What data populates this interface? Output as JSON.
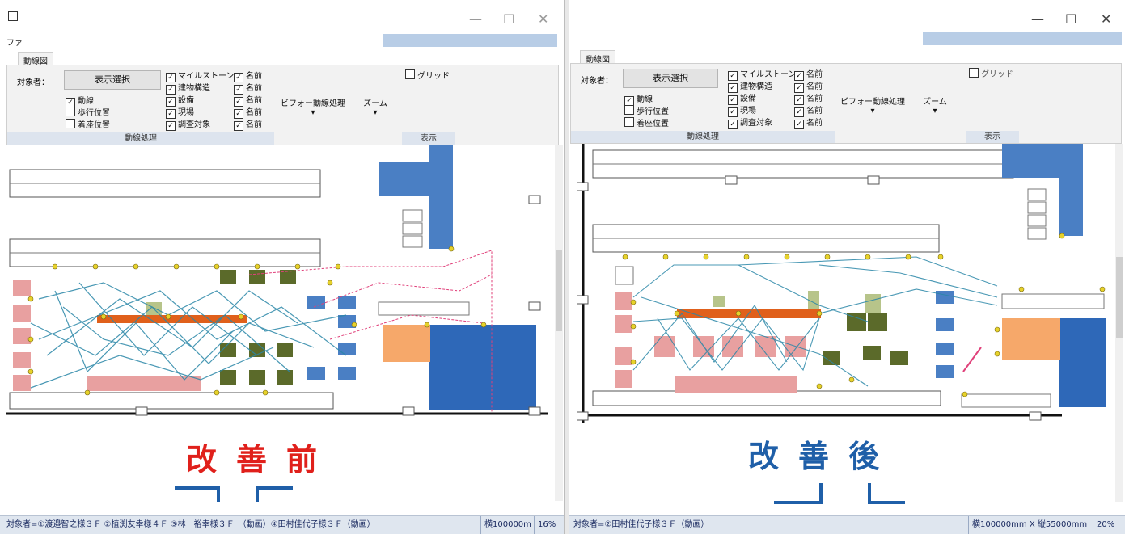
{
  "left": {
    "menu": "ファ",
    "tab": "動線図",
    "subject_label": "対象者：",
    "select_button": "表示選択",
    "checks": [
      {
        "label": "動線",
        "checked": true
      },
      {
        "label": "歩行位置",
        "checked": false
      },
      {
        "label": "着座位置",
        "checked": false
      }
    ],
    "checks2": [
      {
        "label": "マイルストーン",
        "checked": true
      },
      {
        "label": "建物構造",
        "checked": true
      },
      {
        "label": "設備",
        "checked": true
      },
      {
        "label": "現場",
        "checked": true
      },
      {
        "label": "調査対象",
        "checked": true
      }
    ],
    "names": [
      "名前",
      "名前",
      "名前",
      "名前",
      "名前"
    ],
    "group_label": "動線処理",
    "before_after": "ビフォー動線処理",
    "zoom": "ズーム",
    "grid": "グリッド",
    "display_label": "表示",
    "caption": "改善前",
    "status_text": "対象者=①渡邉智之様３Ｆ ②植渕友幸様４Ｆ ③林　裕幸様３Ｆ　（動画）④田村佳代子様３Ｆ（動画）",
    "status_size": "横100000m",
    "status_zoom": "16%"
  },
  "right": {
    "tab": "動線図",
    "subject_label": "対象者：",
    "select_button": "表示選択",
    "checks": [
      {
        "label": "動線",
        "checked": true
      },
      {
        "label": "歩行位置",
        "checked": false
      },
      {
        "label": "着座位置",
        "checked": false
      }
    ],
    "checks2": [
      {
        "label": "マイルストーン",
        "checked": true
      },
      {
        "label": "建物構造",
        "checked": true
      },
      {
        "label": "設備",
        "checked": true
      },
      {
        "label": "現場",
        "checked": true
      },
      {
        "label": "調査対象",
        "checked": true
      }
    ],
    "names": [
      "名前",
      "名前",
      "名前",
      "名前",
      "名前"
    ],
    "group_label": "動線処理",
    "before_after": "ビフォー動線処理",
    "zoom": "ズーム",
    "grid": "グリッド",
    "display_label": "表示",
    "caption": "改善後",
    "status_text": "対象者=②田村佳代子様３Ｆ（動画）",
    "status_size": "横100000mm X 縦55000mm",
    "status_zoom": "20%"
  },
  "colors": {
    "before": "#e0201b",
    "after": "#1f5fa8",
    "equip_blue": "#4a7fc4",
    "equip_green": "#5b6a2a",
    "equip_pink": "#e8a0a0",
    "equip_orange": "#f6a86a",
    "path_line": "#2a87a8",
    "path_pink": "#e0407a"
  }
}
